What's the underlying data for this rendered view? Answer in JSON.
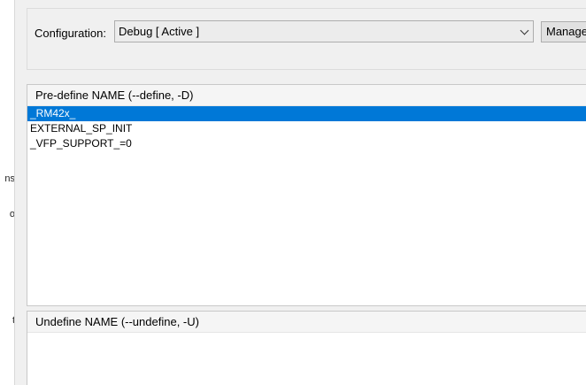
{
  "left_strip": {
    "fragments": [
      "ns",
      "o",
      "t"
    ]
  },
  "configuration": {
    "label": "Configuration:",
    "selected_value": "Debug  [ Active ]",
    "manage_button_label": "Manage"
  },
  "predefine": {
    "header": "Pre-define NAME (--define, -D)",
    "items": [
      "_RM42x_",
      "EXTERNAL_SP_INIT",
      "_VFP_SUPPORT_=0"
    ],
    "selected_index": 0
  },
  "undefine": {
    "header": "Undefine NAME (--undefine, -U)",
    "items": []
  },
  "colors": {
    "selection": "#0078d7",
    "background": "#f0f0f0"
  }
}
